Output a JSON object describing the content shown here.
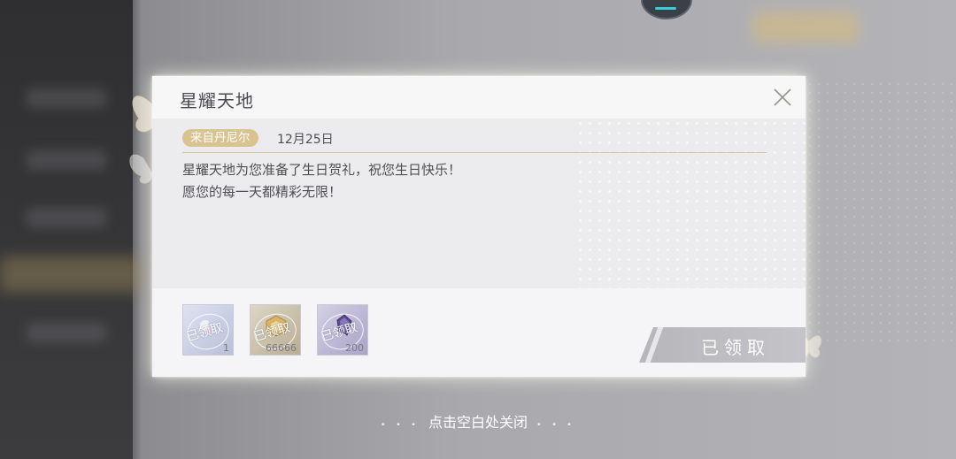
{
  "dialog": {
    "title": "星耀天地",
    "sender": "来自丹尼尔",
    "date": "12月25日",
    "body_lines": [
      "星耀天地为您准备了生日贺礼，祝您生日快乐！",
      "愿您的每一天都精彩无限！"
    ],
    "items": [
      {
        "icon": "crystal-gift-icon",
        "stamp": "已领取",
        "quantity": "1"
      },
      {
        "icon": "gold-box-icon",
        "stamp": "已领取",
        "quantity": "66666"
      },
      {
        "icon": "purple-gem-icon",
        "stamp": "已领取",
        "quantity": "200"
      }
    ],
    "claim_button_label": "已领取"
  },
  "footer": {
    "close_hint": "点击空白处关闭"
  },
  "colors": {
    "badge_gold": "#d8c391",
    "accent_cyan": "#34d0d6",
    "claimed_gray": "#b6b6bb"
  }
}
